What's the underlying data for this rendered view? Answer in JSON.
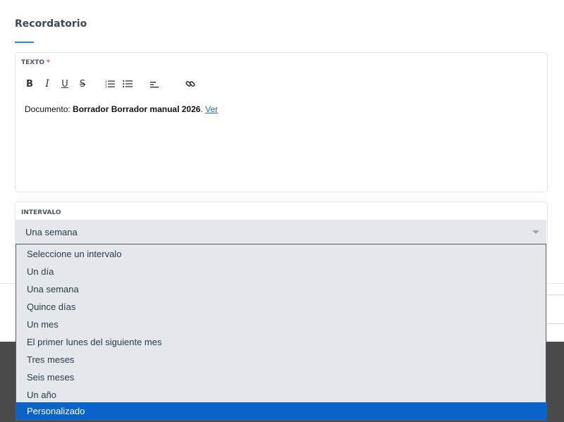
{
  "section": {
    "title": "Recordatorio",
    "accent_color": "#1a8fd6"
  },
  "text_field": {
    "label": "TEXTO",
    "required_mark": "*",
    "toolbar": [
      {
        "name": "bold-button",
        "icon": "bold-icon"
      },
      {
        "name": "italic-button",
        "icon": "italic-icon"
      },
      {
        "name": "underline-button",
        "icon": "underline-icon"
      },
      {
        "name": "strikethrough-button",
        "icon": "strikethrough-icon"
      },
      {
        "name": "ordered-list-button",
        "icon": "ordered-list-icon"
      },
      {
        "name": "bullet-list-button",
        "icon": "bullet-list-icon"
      },
      {
        "name": "align-button",
        "icon": "align-left-icon"
      },
      {
        "name": "link-button",
        "icon": "link-icon"
      }
    ],
    "content": {
      "prefix": "Documento: ",
      "bold": "Borrador Borrador manual 2026",
      "separator": ". ",
      "link": "Ver"
    }
  },
  "interval_field": {
    "label": "INTERVALO",
    "selected_value": "Una semana",
    "options": [
      "Seleccione un intervalo",
      "Un día",
      "Una semana",
      "Quince días",
      "Un mes",
      "El primer lunes del siguiente mes",
      "Tres meses",
      "Seis meses",
      "Un año",
      "Personalizado"
    ],
    "highlighted_option": "Personalizado",
    "highlight_color": "#0a63c9"
  }
}
